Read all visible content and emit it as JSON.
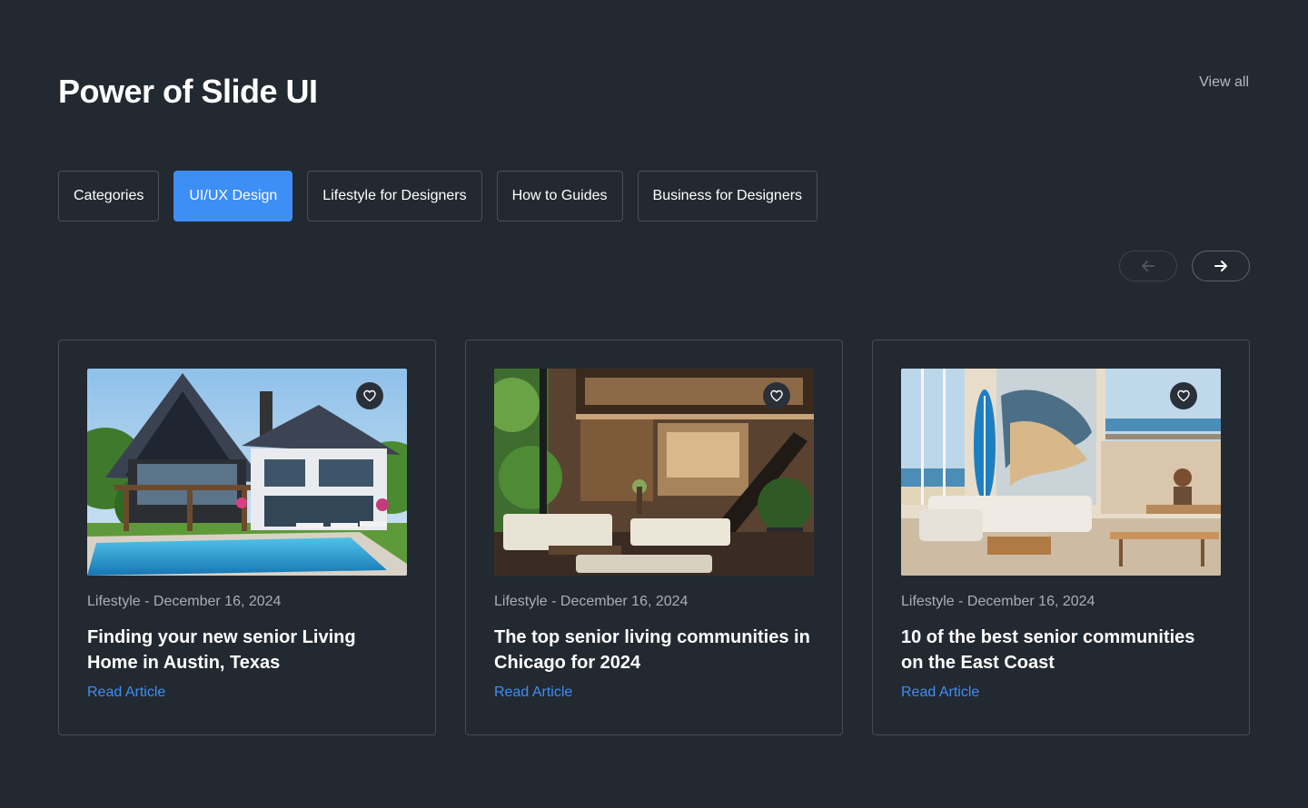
{
  "header": {
    "title": "Power of Slide UI",
    "view_all": "View all"
  },
  "tabs": [
    {
      "label": "Categories",
      "active": false
    },
    {
      "label": "UI/UX Design",
      "active": true
    },
    {
      "label": "Lifestyle for Designers",
      "active": false
    },
    {
      "label": "How to Guides",
      "active": false
    },
    {
      "label": "Business for Designers",
      "active": false
    }
  ],
  "navigation": {
    "prev_icon": "arrow-left-icon",
    "next_icon": "arrow-right-icon"
  },
  "cards": [
    {
      "meta": "Lifestyle - December 16, 2024",
      "title": "Finding your new senior Living Home in Austin, Texas",
      "link": "Read Article",
      "image": "modern-house-with-pool"
    },
    {
      "meta": "Lifestyle - December 16, 2024",
      "title": "The top senior living communities in Chicago for 2024",
      "link": "Read Article",
      "image": "double-height-living-room-interior"
    },
    {
      "meta": "Lifestyle - December 16, 2024",
      "title": "10 of the best senior communities on the East Coast",
      "link": "Read Article",
      "image": "beach-house-living-room-with-surfboard"
    }
  ],
  "colors": {
    "background": "#232931",
    "accent": "#3d8ef5",
    "border": "#454c55",
    "muted_text": "#a9afb7"
  }
}
